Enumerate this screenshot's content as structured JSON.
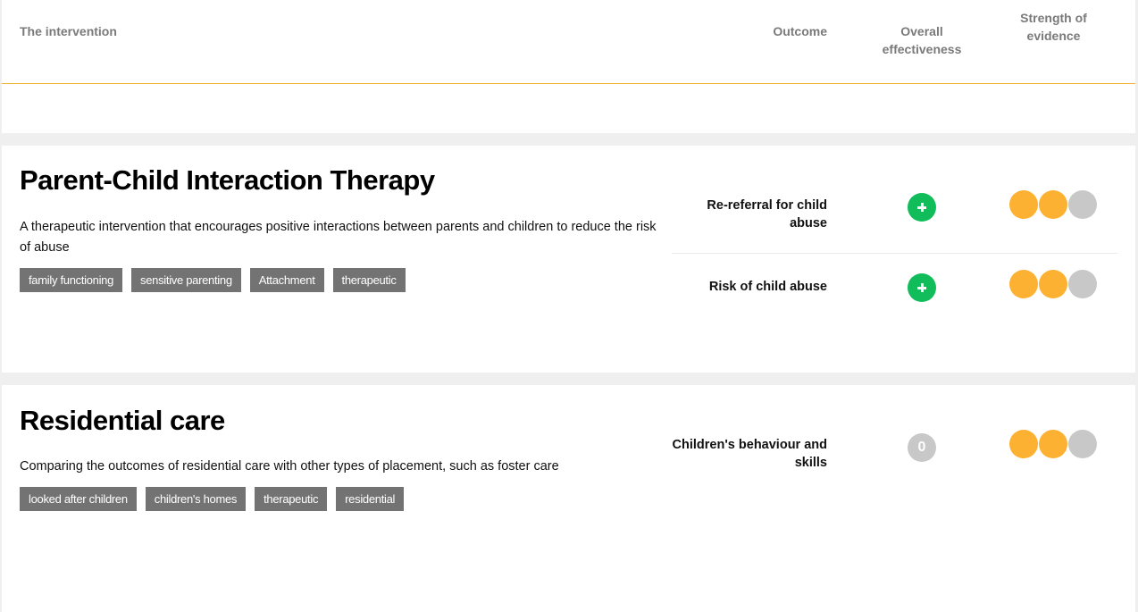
{
  "header": {
    "columns": {
      "intervention": "The intervention",
      "outcome": "Outcome",
      "effectiveness": "Overall effectiveness",
      "strength": "Strength of evidence"
    }
  },
  "colors": {
    "accent_line": "#f0b53a",
    "positive": "#10bd5a",
    "neutral": "#c8c8c8",
    "evidence_filled": "#fdb133",
    "evidence_empty": "#c8c8c8",
    "tag_bg": "#737373",
    "page_bg": "#efefef"
  },
  "interventions": [
    {
      "title": "Parent-Child Interaction Therapy",
      "description": "A therapeutic intervention that encourages positive interactions between parents and children to reduce the risk of abuse",
      "tags": [
        "family functioning",
        "sensitive parenting",
        "Attachment",
        "therapeutic"
      ],
      "outcomes": [
        {
          "label": "Re-referral for child abuse",
          "effectiveness": "positive",
          "effectiveness_icon": "plus-icon",
          "strength": 2,
          "strength_max": 3
        },
        {
          "label": "Risk of child abuse",
          "effectiveness": "positive",
          "effectiveness_icon": "plus-icon",
          "strength": 2,
          "strength_max": 3
        }
      ]
    },
    {
      "title": "Residential care",
      "description": "Comparing the outcomes of residential care with other types of placement, such as foster care",
      "tags": [
        "looked after children",
        "children's homes",
        "therapeutic",
        "residential"
      ],
      "outcomes": [
        {
          "label": "Children's behaviour and skills",
          "effectiveness": "neutral",
          "effectiveness_text": "0",
          "strength": 2,
          "strength_max": 3
        }
      ]
    }
  ]
}
